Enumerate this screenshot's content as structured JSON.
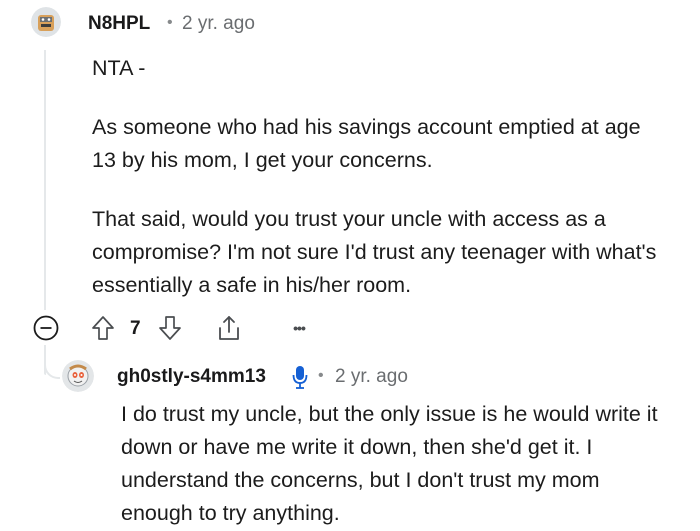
{
  "comment": {
    "author": "N8HPL",
    "time": "2 yr. ago",
    "paragraphs": [
      "NTA -",
      "As someone who had his savings account emptied at age 13 by his mom, I get your concerns.",
      "That said, would you trust your uncle with access as a compromise? I'm not sure I'd trust any teenager with what's essentially a safe in his/her room."
    ],
    "score": "7",
    "more_label": "•••"
  },
  "reply": {
    "author": "gh0stly-s4mm13",
    "time": "2 yr. ago",
    "text": "I do trust my uncle, but the only issue is he would write it down or have me write it down, then she'd get it. I understand the concerns, but I don't trust my mom enough to try anything."
  },
  "icons": [
    "collapse-icon",
    "upvote-icon",
    "downvote-icon",
    "share-icon",
    "more-icon",
    "microphone-icon"
  ],
  "colors": {
    "text": "#1c1c1c",
    "meta": "#6a6d70",
    "icon": "#4a4d50",
    "thread_line": "#e5e8ea"
  }
}
